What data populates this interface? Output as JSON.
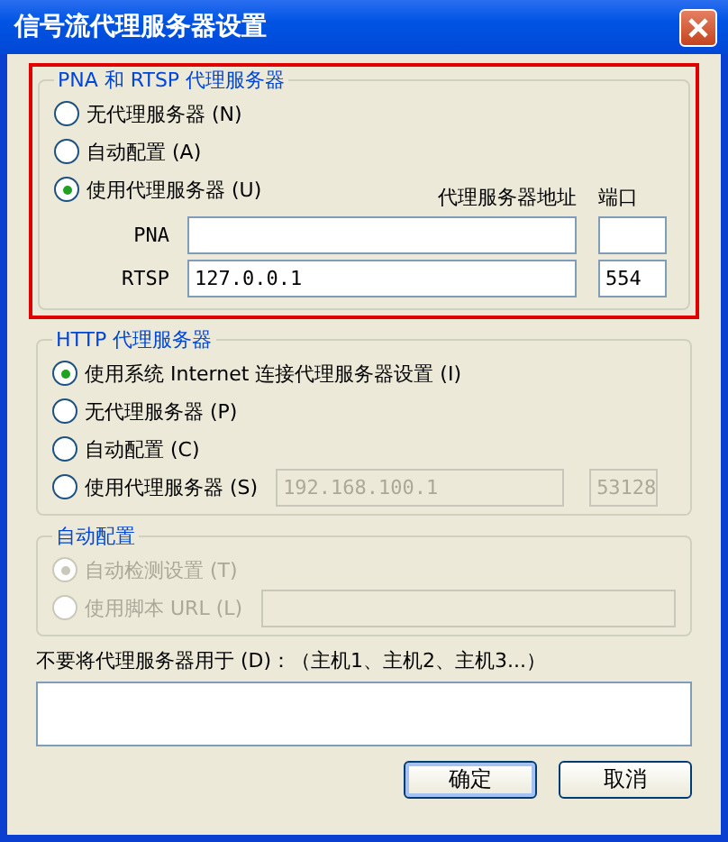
{
  "window": {
    "title": "信号流代理服务器设置"
  },
  "pna_rtsp_group": {
    "title": "PNA 和 RTSP 代理服务器",
    "options": [
      {
        "label": "无代理服务器 (N)",
        "selected": false
      },
      {
        "label": "自动配置 (A)",
        "selected": false
      },
      {
        "label": "使用代理服务器 (U)",
        "selected": true
      }
    ],
    "address_header": "代理服务器地址",
    "port_header": "端口",
    "proxies": [
      {
        "protocol": "PNA"
      },
      {
        "protocol": "RTSP",
        "address": "127.0.0.1",
        "port": "554"
      }
    ]
  },
  "http_group": {
    "title": "HTTP 代理服务器",
    "options": [
      {
        "label": "使用系统 Internet 连接代理服务器设置 (I)",
        "selected": true
      },
      {
        "label": "无代理服务器 (P)",
        "selected": false
      },
      {
        "label": "自动配置 (C)",
        "selected": false
      },
      {
        "label": "使用代理服务器 (S)",
        "selected": false,
        "address": "192.168.100.1",
        "port": "53128"
      }
    ]
  },
  "auto_config": {
    "title": "自动配置",
    "disabled": true,
    "options": [
      {
        "label": "自动检测设置 (T)",
        "selected": true
      },
      {
        "label": "使用脚本 URL (L)",
        "selected": false,
        "has_field": true
      }
    ]
  },
  "bypass": {
    "label": "不要将代理服务器用于 (D)：（主机1、主机2、主机3...）"
  },
  "buttons": [
    {
      "label": "确定",
      "default": true
    },
    {
      "label": "取消",
      "default": false
    }
  ]
}
